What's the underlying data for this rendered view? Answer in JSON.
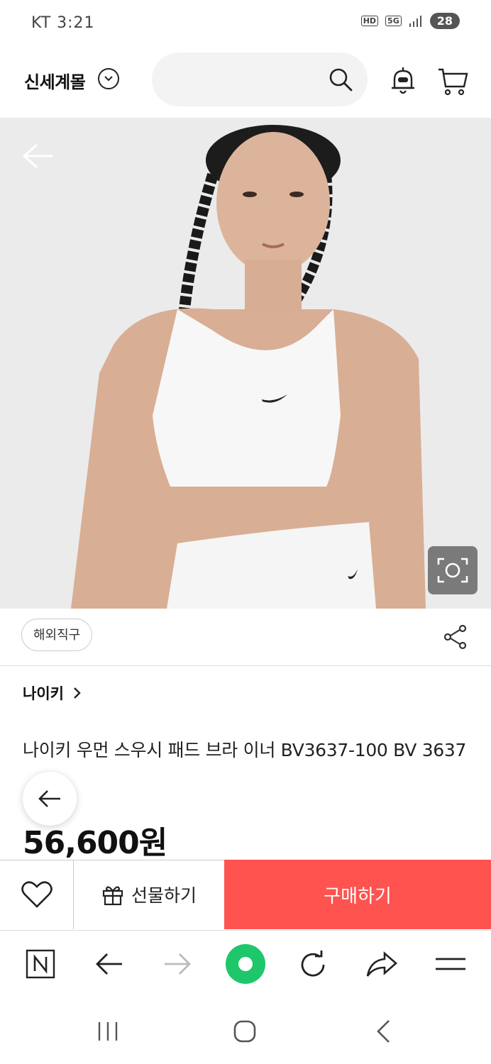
{
  "status_bar": {
    "carrier_time": "KT 3:21",
    "hd_badge": "HD",
    "network_badge": "5G",
    "battery": "28"
  },
  "header": {
    "mall_name": "신세계몰",
    "icons": [
      "chevron-down-icon",
      "search-icon",
      "bell-robot-icon",
      "cart-icon"
    ]
  },
  "product": {
    "tag": "해외직구",
    "brand": "나이키",
    "title": "나이키 우먼 스우시 패드 브라 이너 BV3637-100 BV 3637",
    "price": "56,600원"
  },
  "actions": {
    "gift_label": "선물하기",
    "buy_label": "구매하기",
    "buy_color": "#ff5350"
  },
  "browser_bar": {
    "icons": [
      "naver-n-icon",
      "back-arrow-icon",
      "forward-arrow-icon",
      "green-dot-icon",
      "refresh-icon",
      "share-arrow-icon",
      "menu-icon"
    ]
  },
  "nav_bar": {
    "icons": [
      "recent-apps-icon",
      "home-icon",
      "back-icon"
    ]
  }
}
